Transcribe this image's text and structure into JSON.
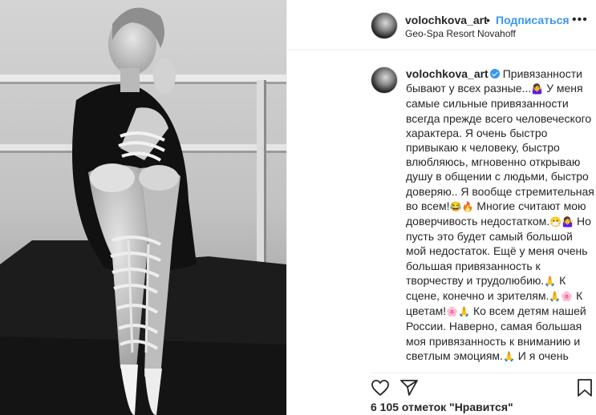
{
  "header": {
    "username": "volochkova_art",
    "separator": "•",
    "follow_label": "Подписаться",
    "location": "Geo-Spa Resort Novahoff",
    "more_label": "•••"
  },
  "caption": {
    "username": "volochkova_art",
    "parts": [
      "Привязанности бывают у всех разные...",
      "🤷‍♀️",
      " У меня самые сильные привязанности всегда прежде всего человеческого характера. Я очень быстро привыкаю к человеку, быстро влюбляюсь, мгновенно открываю душу в общении с людьми, быстро доверяю.. Я вообще стремительная во всем!",
      "😂🔥",
      " Многие считают мою доверчивость недостатком.",
      "😷🤷‍♀️",
      " Но пусть это будет самый большой мой недостаток. Ещё у меня очень большая привязанность к творчеству и трудолюбию.",
      "🙏",
      " К сцене, конечно и зрителям.",
      "🙏🌸",
      " К цветам!",
      "🌸🙏",
      " Ко всем детям нашей России. Наверно, самая большая моя привязанность к вниманию и светлым эмоциям.",
      "🙏",
      " И я очень тяжело переживаю"
    ]
  },
  "actions": {
    "like_icon": "heart-icon",
    "share_icon": "share-icon",
    "save_icon": "bookmark-icon"
  },
  "likes": {
    "text": "6 105 отметок \"Нравится\""
  },
  "colors": {
    "accent": "#3897f0",
    "text": "#262626",
    "border": "#efefef"
  }
}
